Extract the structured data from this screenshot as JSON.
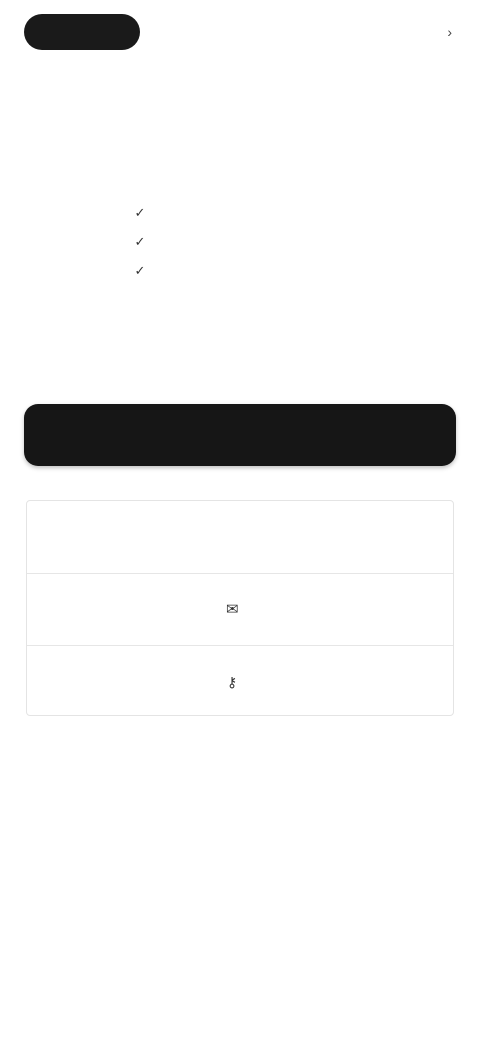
{
  "header": {
    "brand_label": "",
    "top_link_label": "",
    "top_link_icon": "arrow-right-icon"
  },
  "hero": {
    "title": "",
    "features": [
      {
        "icon": "check-icon",
        "label": ""
      },
      {
        "icon": "check-icon",
        "label": ""
      },
      {
        "icon": "check-icon",
        "label": ""
      }
    ]
  },
  "primary_action": {
    "label": ""
  },
  "options": {
    "rows": [
      {
        "label": "",
        "icon": ""
      },
      {
        "label": "",
        "icon": "mail-icon"
      },
      {
        "label": "",
        "icon": "key-icon"
      }
    ]
  },
  "footer": {
    "heading": "",
    "link_label": "",
    "legal_text": ""
  },
  "colors": {
    "primary_button": "#161616",
    "brand_pill": "#1a1a1a",
    "panel_border": "#e4e4e4"
  }
}
